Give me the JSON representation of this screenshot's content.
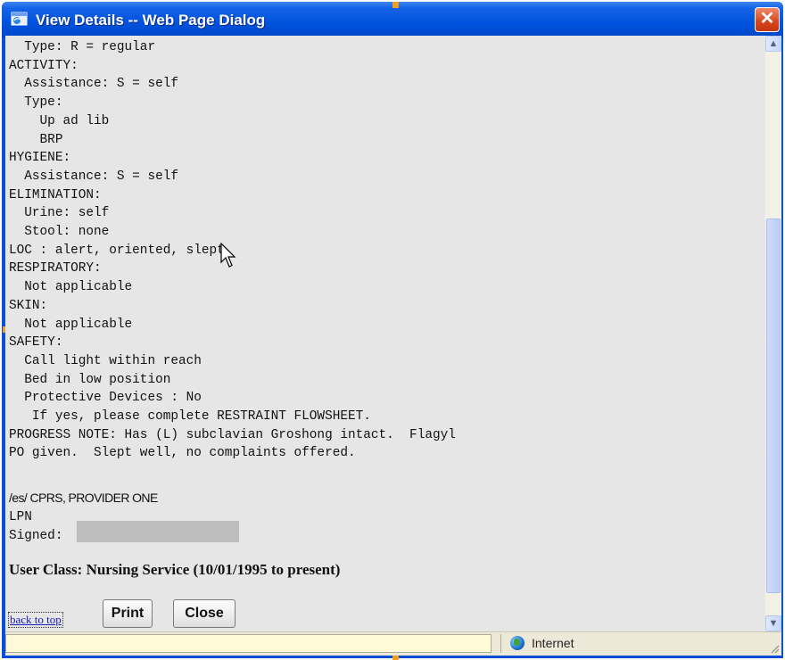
{
  "window": {
    "title": "View Details -- Web Page Dialog",
    "close_label": "✕"
  },
  "note": {
    "text": "  Type: R = regular\nACTIVITY:\n  Assistance: S = self\n  Type:\n    Up ad lib\n    BRP\nHYGIENE:\n  Assistance: S = self\nELIMINATION:\n  Urine: self\n  Stool: none\nLOC : alert, oriented, slept\nRESPIRATORY:\n  Not applicable\nSKIN:\n  Not applicable\nSAFETY:\n  Call light within reach\n  Bed in low position\n  Protective Devices : No\n   If yes, please complete RESTRAINT FLOWSHEET.\nPROGRESS NOTE: Has (L) subclavian Groshong intact.  Flagyl\nPO given.  Slept well, no complaints offered.",
    "signature": "/es/ CPRS, PROVIDER ONE",
    "role": "LPN",
    "signed_label": "Signed:",
    "user_class": "User Class: Nursing Service (10/01/1995 to present)"
  },
  "footer": {
    "back_to_top": "back to top",
    "print_label": "Print",
    "close_label": "Close"
  },
  "status": {
    "zone": "Internet"
  }
}
